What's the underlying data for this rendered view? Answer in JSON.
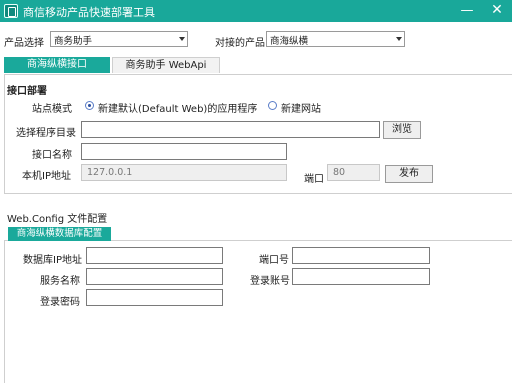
{
  "window": {
    "title": "商信移动产品快速部署工具",
    "minimize_glyph": "—",
    "close_glyph": "✕",
    "icon": "app-icon"
  },
  "product_row": {
    "product_label": "产品选择",
    "product_value": "商务助手",
    "target_label": "对接的产品",
    "target_value": "商海纵横"
  },
  "tabs": [
    {
      "label": "商海纵横接口",
      "active": true
    },
    {
      "label": "商务助手 WebApi",
      "active": false
    }
  ],
  "deploy": {
    "section_title": "接口部署",
    "site_mode_label": "站点模式",
    "radio_default_web": "新建默认(Default Web)的应用程序",
    "radio_new_site": "新建网站",
    "dir_label": "选择程序目录",
    "dir_value": "",
    "browse_button": "浏览",
    "name_label": "接口名称",
    "name_value": "",
    "ip_label": "本机IP地址",
    "ip_value": "127.0.0.1",
    "port_label": "端口",
    "port_value": "80",
    "publish_button": "发布"
  },
  "webconfig": {
    "section_title": "Web.Config 文件配置",
    "subtab_label": "商海纵横数据库配置",
    "db_ip_label": "数据库IP地址",
    "db_ip_value": "",
    "port_label": "端口号",
    "port_value": "",
    "service_label": "服务名称",
    "service_value": "",
    "account_label": "登录账号",
    "account_value": "",
    "password_label": "登录密码",
    "password_value": ""
  },
  "colors": {
    "accent": "#19a89a",
    "border": "#cfcfcf"
  }
}
